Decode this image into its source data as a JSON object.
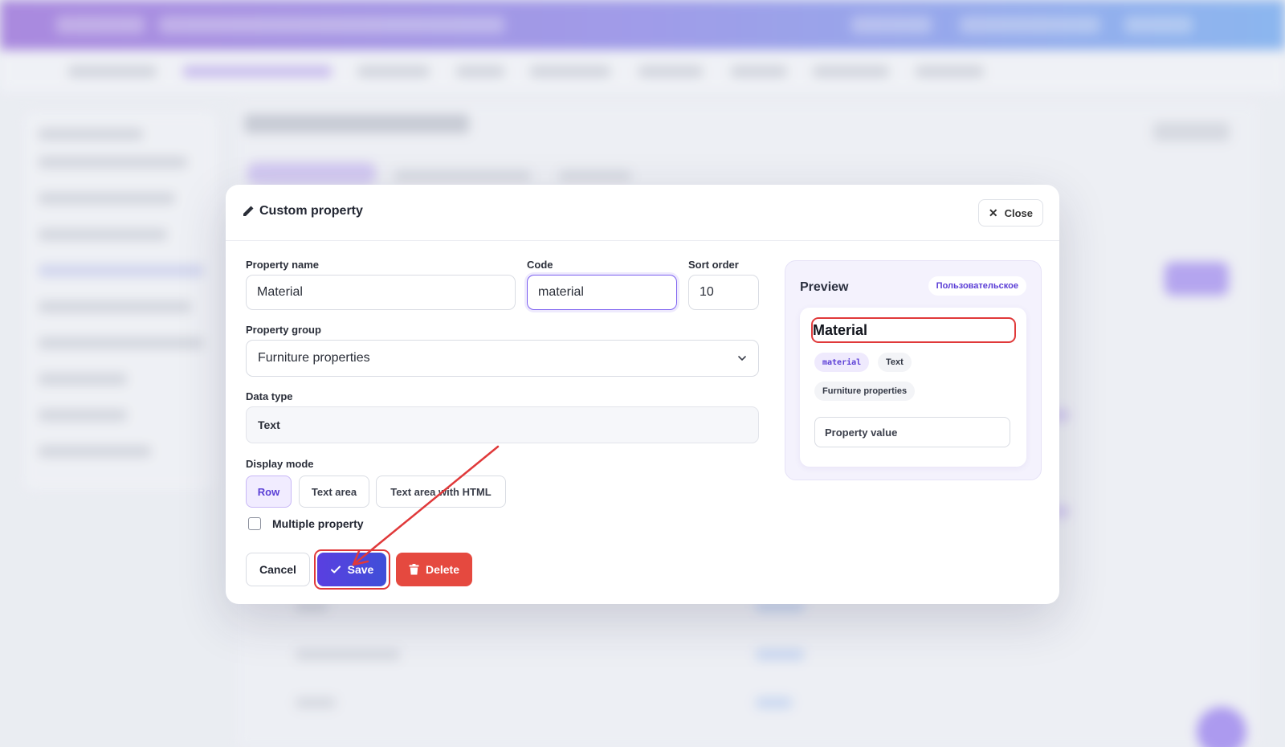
{
  "modal": {
    "title": "Custom property",
    "close_label": "Close",
    "fields": {
      "property_name_label": "Property name",
      "property_name_value": "Material",
      "code_label": "Code",
      "code_value": "material",
      "sort_order_label": "Sort order",
      "sort_order_value": "10",
      "property_group_label": "Property group",
      "property_group_value": "Furniture properties",
      "data_type_label": "Data type",
      "data_type_value": "Text",
      "display_mode_label": "Display mode",
      "display_modes": [
        "Row",
        "Text area",
        "Text area with HTML"
      ],
      "display_mode_selected": "Row",
      "multiple_label": "Multiple property",
      "multiple_checked": false
    },
    "actions": {
      "cancel_label": "Cancel",
      "save_label": "Save",
      "delete_label": "Delete"
    },
    "preview": {
      "title": "Preview",
      "badge": "Пользовательское",
      "name": "Material",
      "code_chip": "material",
      "type_chip": "Text",
      "group_chip": "Furniture properties",
      "value_placeholder": "Property value"
    }
  },
  "colors": {
    "accent": "#5a3fe0",
    "delete": "#e5493f",
    "annotation": "#e0393a",
    "header_gradient_start": "#8a55d6",
    "header_gradient_end": "#5b9cf0"
  },
  "icons": [
    "pencil-icon",
    "close-icon",
    "chevron-down-icon",
    "check-icon",
    "trash-icon"
  ]
}
